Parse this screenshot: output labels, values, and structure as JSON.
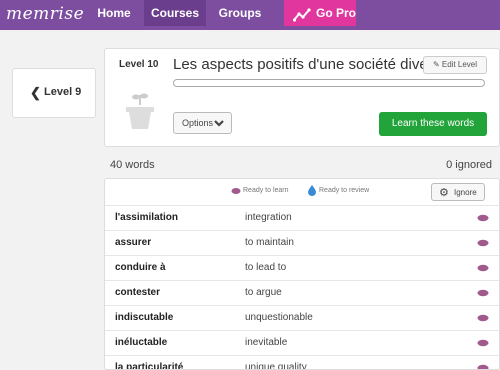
{
  "nav": {
    "logo": "memrise",
    "links": [
      "Home",
      "Courses",
      "Groups"
    ],
    "gopro": "Go Pro"
  },
  "prev_level": {
    "label": "Level 9"
  },
  "level": {
    "number_label": "Level 10",
    "title": "Les aspects positifs d'une société diversifiée",
    "edit_label": "Edit Level",
    "options_label": "Options",
    "learn_label": "Learn these words",
    "progress": 0
  },
  "counts": {
    "words": "40 words",
    "ignored": "0 ignored"
  },
  "legend": {
    "learn": "Ready to learn",
    "review": "Ready to review",
    "ignore_label": "Ignore"
  },
  "words": [
    {
      "word": "l'assimilation",
      "definition": "integration"
    },
    {
      "word": "assurer",
      "definition": "to maintain"
    },
    {
      "word": "conduire à",
      "definition": "to lead to"
    },
    {
      "word": "contester",
      "definition": "to argue"
    },
    {
      "word": "indiscutable",
      "definition": "unquestionable"
    },
    {
      "word": "inéluctable",
      "definition": "inevitable"
    },
    {
      "word": "la particularité",
      "definition": "unique quality"
    }
  ],
  "colors": {
    "nav": "#7d4ea0",
    "gopro": "#e0369e",
    "learn_button": "#22a43a",
    "seed": "#a05a8c",
    "drop": "#3a8ad6"
  }
}
